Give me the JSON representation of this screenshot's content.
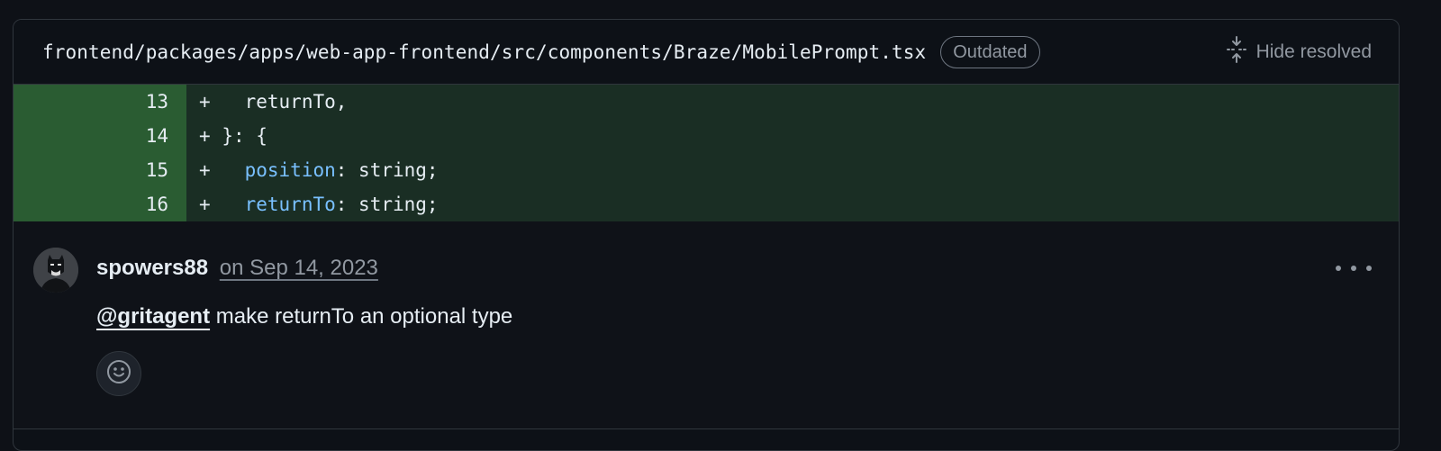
{
  "file": {
    "path": "frontend/packages/apps/web-app-frontend/src/components/Braze/MobilePrompt.tsx",
    "badge": "Outdated",
    "hide_resolved_label": "Hide resolved"
  },
  "diff": {
    "lines": [
      {
        "number": "13",
        "marker": "+",
        "indent": "  ",
        "prop": "",
        "text": "returnTo,"
      },
      {
        "number": "14",
        "marker": "+",
        "indent": "",
        "prop": "",
        "text": "}: {"
      },
      {
        "number": "15",
        "marker": "+",
        "indent": "  ",
        "prop": "position",
        "text": ": string;"
      },
      {
        "number": "16",
        "marker": "+",
        "indent": "  ",
        "prop": "returnTo",
        "text": ": string;"
      }
    ]
  },
  "comment": {
    "author": "spowers88",
    "timestamp": "on Sep 14, 2023",
    "mention": "@gritagent",
    "body": " make returnTo an optional type"
  },
  "icons": {
    "hide_resolved": "unfold-collapse-icon",
    "more": "kebab-horizontal-icon",
    "reaction": "smiley-icon",
    "avatar": "batman-avatar"
  },
  "colors": {
    "background": "#0d1117",
    "added_line_number_bg": "#2a5c32",
    "added_line_bg": "#1a2e24",
    "property_token": "#79c0ff",
    "muted_text": "#9198a1"
  }
}
